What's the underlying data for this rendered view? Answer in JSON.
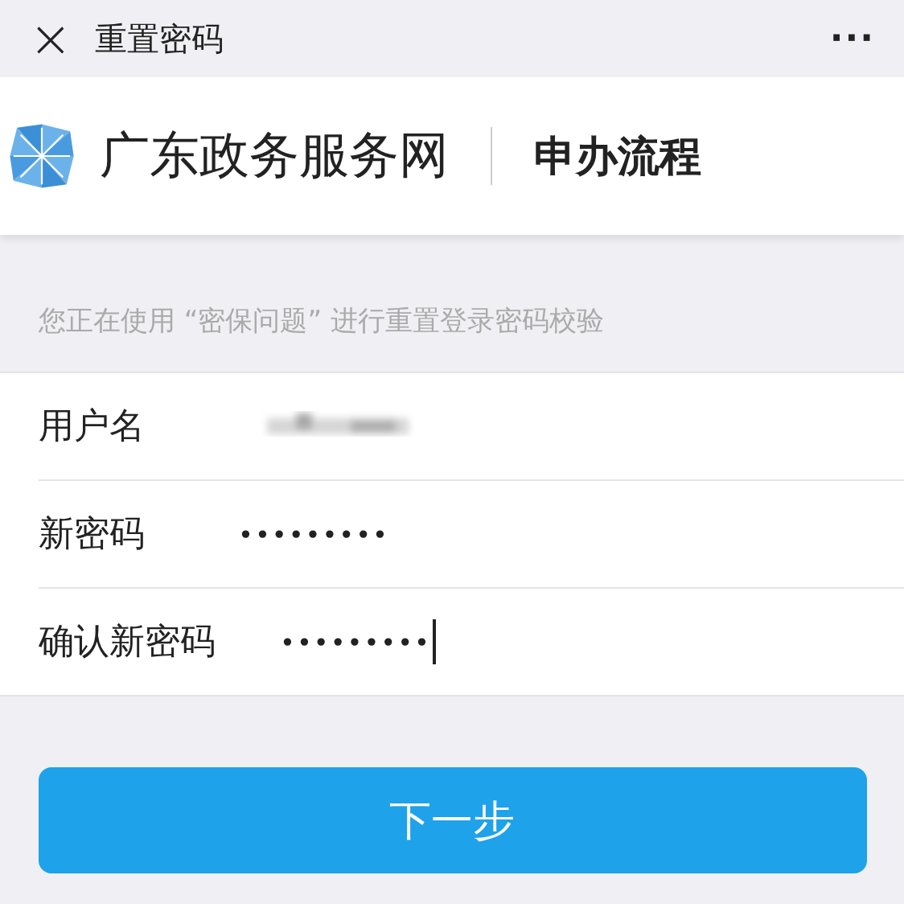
{
  "nav_bar": {
    "close": "×",
    "title": "重置密码",
    "more": "···"
  },
  "header": {
    "site_name": "广东政务服务网",
    "section": "申办流程"
  },
  "notice": "您正在使用 “密保问题” 进行重置登录密码校验",
  "fields": [
    {
      "label": "用户名",
      "kind": "redacted",
      "focused": false
    },
    {
      "label": "新密码",
      "kind": "password",
      "value": "•••••••••",
      "focused": false
    },
    {
      "label": "确认新密码",
      "kind": "password",
      "value": "•••••••••",
      "focused": true
    }
  ],
  "next_button": "下一步"
}
